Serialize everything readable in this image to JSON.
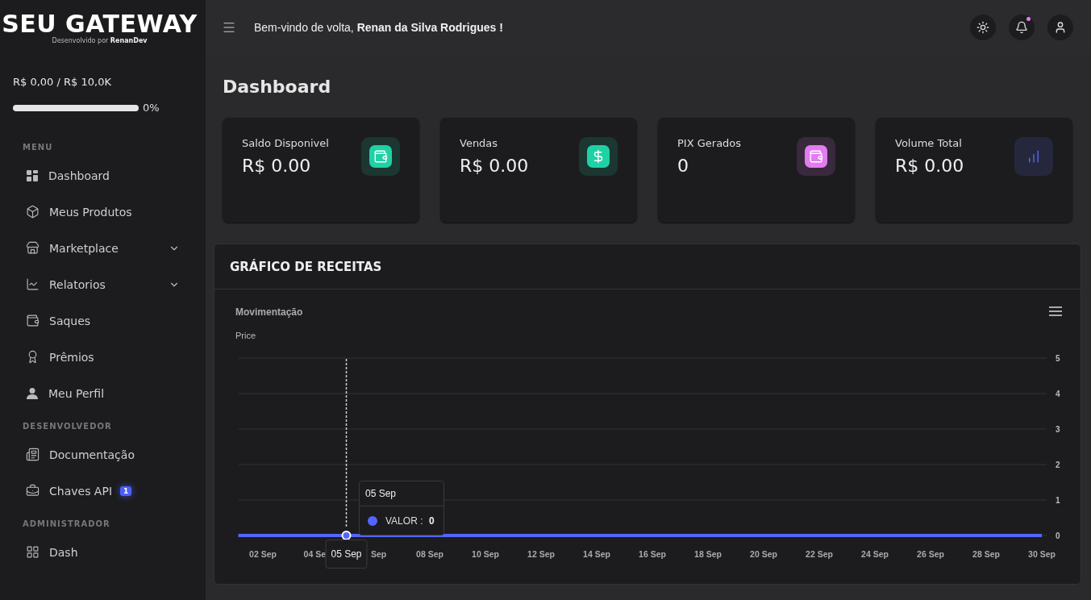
{
  "brand": {
    "logo": "SEU GATEWAY",
    "tagline_prefix": "Desenvolvido por",
    "tagline_author": "RenanDev"
  },
  "goal": {
    "text": "R$ 0,00 / R$ 10,0K",
    "level": 0,
    "percent": "0%"
  },
  "sidebar": {
    "sections": [
      {
        "title": "MENU",
        "items": [
          {
            "kind": "dashboard",
            "label": "Dashboard"
          },
          {
            "kind": "box",
            "label": "Meus Produtos"
          },
          {
            "kind": "store",
            "label": "Marketplace",
            "expanded": false
          },
          {
            "kind": "chart",
            "label": "Relatorios",
            "expanded": false
          },
          {
            "kind": "wallet",
            "label": "Saques"
          },
          {
            "kind": "award",
            "label": "Prêmios"
          },
          {
            "kind": "user",
            "label": "Meu Perfil"
          }
        ]
      },
      {
        "title": "DESENVOLVEDOR",
        "items": [
          {
            "kind": "doc",
            "label": "Documentação"
          },
          {
            "kind": "lock",
            "label": "Chaves API",
            "badge": "1"
          }
        ]
      },
      {
        "title": "ADMINISTRADOR",
        "items": [
          {
            "kind": "grid",
            "label": "Dash"
          }
        ]
      }
    ]
  },
  "header": {
    "greeting": "Bem-vindo de volta, **Renan da Silva Rodrigues !**",
    "unread": true
  },
  "page_title": "Dashboard",
  "stats": [
    {
      "label": "Saldo Disponivel",
      "value": "R$ 0.00",
      "kind": "wallet",
      "color": "#1fd1a5"
    },
    {
      "label": "Vendas",
      "value": "R$ 0.00",
      "kind": "dollar",
      "color": "#1fd1a5"
    },
    {
      "label": "PIX Gerados",
      "value": "0",
      "kind": "wallet",
      "color": "#e27cf0"
    },
    {
      "label": "Volume Total",
      "value": "R$ 0.00",
      "kind": "bars",
      "color": "#5b6cf0"
    }
  ],
  "revenue_panel": {
    "title": "GRÁFICO DE RECEITAS",
    "chart_data": {
      "type": "line",
      "title": "Movimentação",
      "ylabel": "Price",
      "categories": [
        null,
        "02 Sep",
        null,
        "04 Se",
        "05 Sep",
        "Sep",
        null,
        "08 Sep",
        null,
        "10 Sep",
        null,
        "12 Sep",
        null,
        "14 Sep",
        null,
        "16 Sep",
        null,
        "18 Sep",
        null,
        "20 Sep",
        null,
        "22 Sep",
        null,
        "24 Sep",
        null,
        "26 Sep",
        null,
        "28 Sep",
        null,
        "30 Sep"
      ],
      "series": [
        {
          "name": "VALOR",
          "color": "#5465ff",
          "values": [
            0,
            0,
            0,
            0,
            0,
            0,
            0,
            0,
            0,
            0,
            0,
            0,
            0,
            0,
            0,
            0,
            0,
            0,
            0,
            0,
            0,
            0,
            0,
            0,
            0,
            0,
            0,
            0,
            0,
            0
          ]
        }
      ],
      "ylim": [
        0,
        5
      ],
      "yticks": [
        0,
        1,
        2,
        3,
        4,
        5
      ],
      "grid": true
    },
    "tooltip": {
      "date": "05 Sep",
      "separator": ":",
      "value": "0"
    }
  }
}
